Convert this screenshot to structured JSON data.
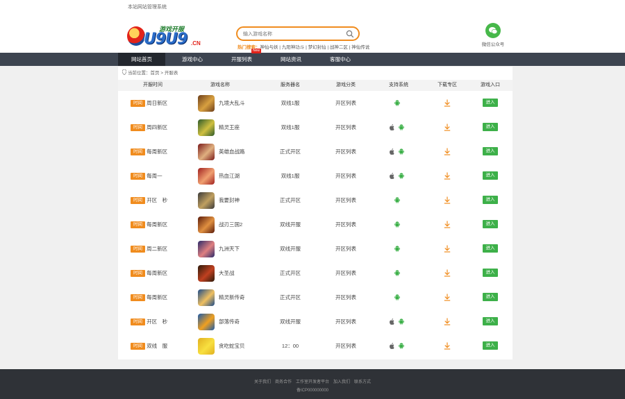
{
  "topbar": {
    "note": "本站网站管理系统"
  },
  "header": {
    "logo_sub": "游戏开服",
    "logo_text": "U9U9",
    "logo_cn": ".CN",
    "search_placeholder": "输入游戏名称",
    "hot_label": "热门搜索：",
    "hot_text": "神仙与妖 | 九阳神功斗 | 梦幻封仙 | 战神二区 | 神仙传说",
    "wechat_label": "微信公众号"
  },
  "nav": {
    "items": [
      {
        "label": "网站首页",
        "active": true
      },
      {
        "label": "游戏中心",
        "active": false
      },
      {
        "label": "开服列表",
        "active": false,
        "badge": "New"
      },
      {
        "label": "网站资讯",
        "active": false
      },
      {
        "label": "客服中心",
        "active": false
      }
    ]
  },
  "breadcrumb": {
    "text": "当前位置：首页 > 开服表"
  },
  "table": {
    "headers": [
      "开服时间",
      "游戏名称",
      "服务器名",
      "游戏分类",
      "支持系统",
      "下载专区",
      "游戏入口"
    ],
    "time_badge": "时间",
    "enter_label": "进入",
    "rows": [
      {
        "time": "周日新区",
        "name": "九境大乱斗",
        "server": "双线1服",
        "category": "开区列表",
        "ios": false,
        "android": true,
        "icon_colors": [
          "#6b3d1a",
          "#d8a040"
        ]
      },
      {
        "time": "周四新区",
        "name": "精灵王座",
        "server": "双线1服",
        "category": "开区列表",
        "ios": true,
        "android": true,
        "icon_colors": [
          "#2c5a2a",
          "#d0c040"
        ]
      },
      {
        "time": "每周新区",
        "name": "英雄血战路",
        "server": "正式开区",
        "category": "开区列表",
        "ios": true,
        "android": true,
        "icon_colors": [
          "#7a1a1a",
          "#e0b080"
        ]
      },
      {
        "time": "每周一",
        "name": "热血江湖",
        "server": "双线1服",
        "category": "开区列表",
        "ios": true,
        "android": true,
        "icon_colors": [
          "#a02020",
          "#f0a070"
        ]
      },
      {
        "time": "开区　秒",
        "name": "我要封神",
        "server": "正式开区",
        "category": "开区列表",
        "ios": false,
        "android": true,
        "icon_colors": [
          "#3a3a3a",
          "#c0a060"
        ]
      },
      {
        "time": "每周新区",
        "name": "战刃三国2",
        "server": "双线开服",
        "category": "开区列表",
        "ios": false,
        "android": true,
        "icon_colors": [
          "#5a1a0a",
          "#e09040"
        ]
      },
      {
        "time": "周二新区",
        "name": "九洲天下",
        "server": "双线开服",
        "category": "开区列表",
        "ios": false,
        "android": true,
        "icon_colors": [
          "#2a2a6a",
          "#e08080"
        ]
      },
      {
        "time": "每周新区",
        "name": "大圣战",
        "server": "正式开区",
        "category": "开区列表",
        "ios": false,
        "android": true,
        "icon_colors": [
          "#2a1a0a",
          "#c04020"
        ]
      },
      {
        "time": "每周新区",
        "name": "精灵新传奇",
        "server": "正式开区",
        "category": "开区列表",
        "ios": false,
        "android": true,
        "icon_colors": [
          "#1a4a8a",
          "#f0c060"
        ]
      },
      {
        "time": "开区　秒",
        "name": "部落传奇",
        "server": "双线开服",
        "category": "开区列表",
        "ios": true,
        "android": true,
        "icon_colors": [
          "#1a5aaa",
          "#f0a020"
        ]
      },
      {
        "time": "双线　服",
        "name": "贪吃蛇宝贝",
        "server": "12：00",
        "category": "开区列表",
        "ios": true,
        "android": true,
        "icon_colors": [
          "#e0b020",
          "#f8e040"
        ]
      }
    ]
  },
  "footer": {
    "links": [
      "关于我们",
      "商务合作",
      "工作室开发者平台",
      "加入我们",
      "联系方式"
    ],
    "icp": "备ICP000000000"
  },
  "colors": {
    "accent": "#f08c1e",
    "enter": "#3db049",
    "nav_bg": "#3d4450",
    "footer_bg": "#2f3237"
  }
}
